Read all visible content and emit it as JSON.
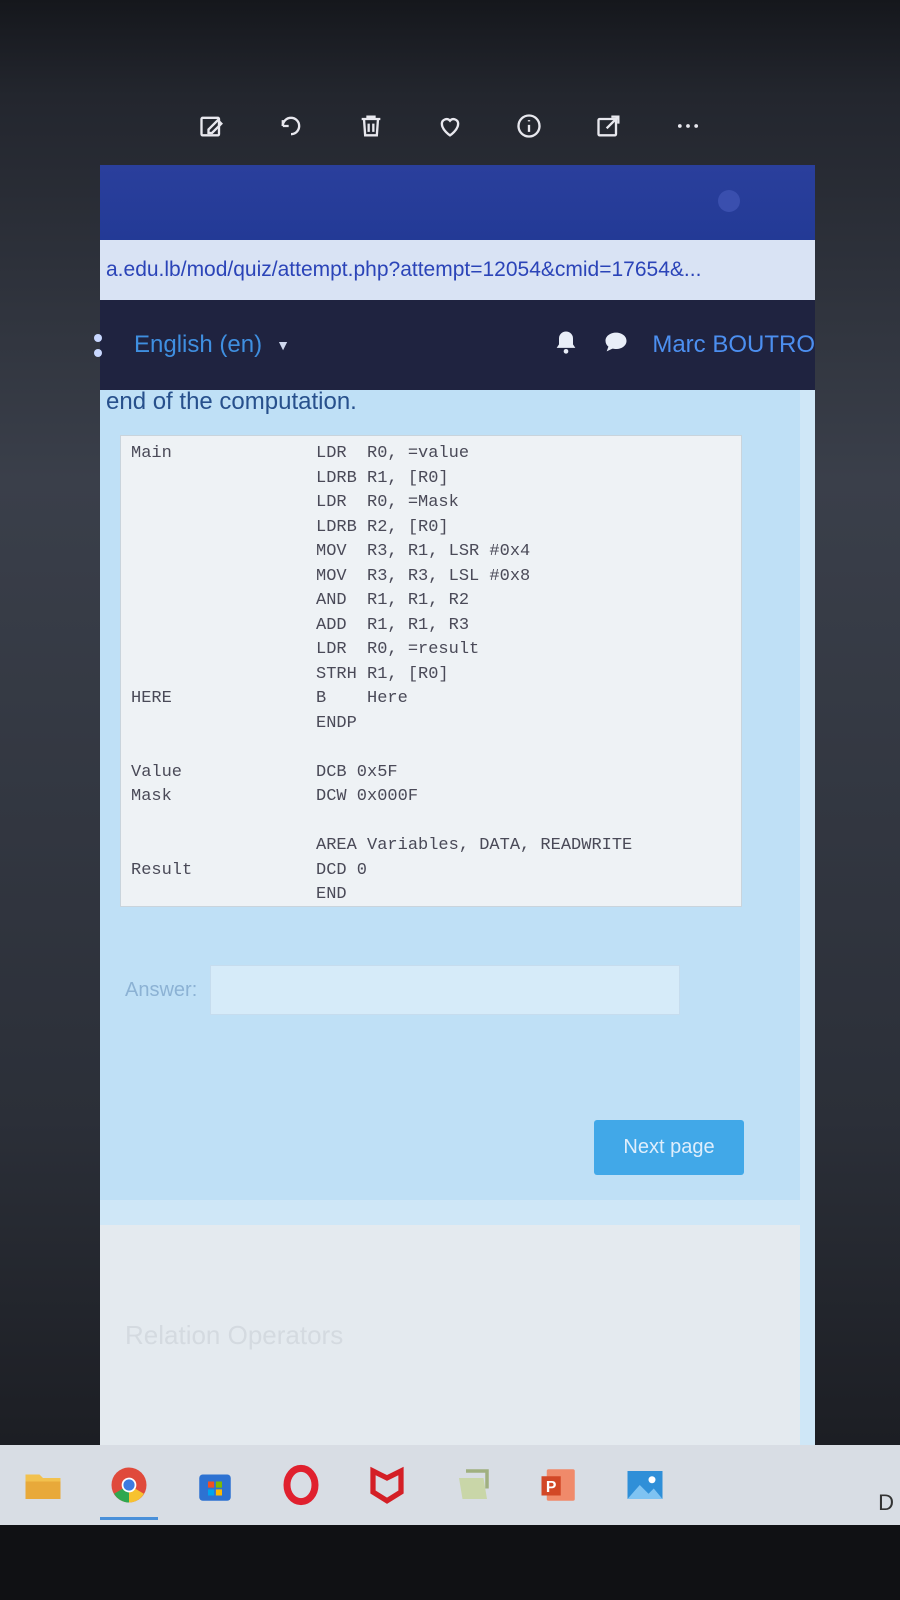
{
  "viewer_toolbar": {
    "icons": [
      "edit-image-icon",
      "rotate-icon",
      "delete-icon",
      "favorite-icon",
      "info-icon",
      "share-icon",
      "more-icon"
    ]
  },
  "browser": {
    "url": "a.edu.lb/mod/quiz/attempt.php?attempt=12054&cmid=17654&..."
  },
  "nav": {
    "language": "English (en)",
    "user_name": "Marc BOUTRO"
  },
  "question": {
    "intro_tail": "end of the computation.",
    "code_lines": [
      {
        "label": "Main",
        "instr": "LDR  R0, =value"
      },
      {
        "label": "",
        "instr": "LDRB R1, [R0]"
      },
      {
        "label": "",
        "instr": "LDR  R0, =Mask"
      },
      {
        "label": "",
        "instr": "LDRB R2, [R0]"
      },
      {
        "label": "",
        "instr": "MOV  R3, R1, LSR #0x4"
      },
      {
        "label": "",
        "instr": "MOV  R3, R3, LSL #0x8"
      },
      {
        "label": "",
        "instr": "AND  R1, R1, R2"
      },
      {
        "label": "",
        "instr": "ADD  R1, R1, R3"
      },
      {
        "label": "",
        "instr": "LDR  R0, =result"
      },
      {
        "label": "",
        "instr": "STRH R1, [R0]"
      },
      {
        "label": "HERE",
        "instr": "B    Here"
      },
      {
        "label": "",
        "instr": "ENDP"
      },
      {
        "label": "Value",
        "instr": "DCB 0x5F"
      },
      {
        "label": "Mask",
        "instr": "DCW 0x000F"
      },
      {
        "label": "",
        "instr": "AREA Variables, DATA, READWRITE"
      },
      {
        "label": "Result",
        "instr": "DCD 0"
      },
      {
        "label": "",
        "instr": "END"
      }
    ],
    "answer_label": "Answer:",
    "answer_value": "",
    "next_button": "Next page"
  },
  "lower_panel": {
    "faded_title": "Relation Operators"
  },
  "taskbar": {
    "icons": [
      "file-explorer-icon",
      "chrome-icon",
      "store-icon",
      "opera-icon",
      "mcafee-icon",
      "notes-icon",
      "powerpoint-icon",
      "photos-icon"
    ],
    "tray_text": "D"
  }
}
